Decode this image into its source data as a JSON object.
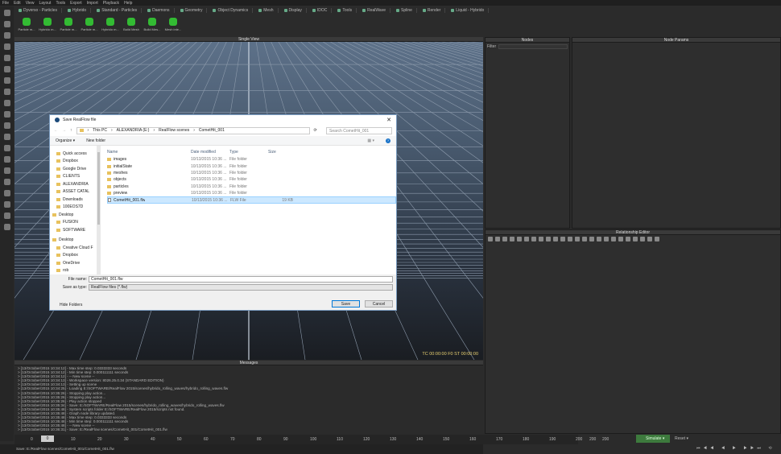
{
  "menu": [
    "File",
    "Edit",
    "View",
    "Layout",
    "Tools",
    "Export",
    "Import",
    "Playback",
    "Help"
  ],
  "shelf_tabs": [
    "Dyverso - Particles",
    "Hybrido",
    "Standard - Particles",
    "Daemons",
    "Geometry",
    "Object Dynamics",
    "Mesh",
    "Display",
    "IDOC",
    "Tools",
    "RealWave",
    "Spline",
    "Render",
    "Liquid - Hybrido"
  ],
  "shelf_tools": [
    "Particle m...",
    "Hybrido m...",
    "Particle m...",
    "Particle m...",
    "Hybrido m...",
    "Build Mesh",
    "Build Mes...",
    "Mesh inte..."
  ],
  "viewport": {
    "title": "Single View",
    "readout": "TC 00:00:00  F0  ST 00:00:00"
  },
  "dialog": {
    "title": "Save RealFlow file",
    "breadcrumb": [
      "This PC",
      "ALEXANDRIA (E:)",
      "RealFlow scenes",
      "CometHit_001"
    ],
    "search_placeholder": "Search CometHit_001",
    "organize": "Organize ▾",
    "new_folder": "New folder",
    "nav": [
      "Quick access",
      "Dropbox",
      "Google Drive",
      "CLIENTS",
      "ALEXANDRIA",
      "ASSET CATAL",
      "Downloads",
      "100EOS7D",
      "Desktop",
      "FUSION",
      "SOFTWARE",
      "Desktop",
      "Creative Cloud F",
      "Dropbox",
      "OneDrive",
      "rob"
    ],
    "columns": [
      "Name",
      "Date modified",
      "Type",
      "Size"
    ],
    "files": [
      {
        "name": "images",
        "date": "10/13/2015 10:36 ...",
        "type": "File folder",
        "size": ""
      },
      {
        "name": "initialState",
        "date": "10/13/2015 10:36 ...",
        "type": "File folder",
        "size": ""
      },
      {
        "name": "meshes",
        "date": "10/13/2015 10:36 ...",
        "type": "File folder",
        "size": ""
      },
      {
        "name": "objects",
        "date": "10/13/2015 10:36 ...",
        "type": "File folder",
        "size": ""
      },
      {
        "name": "particles",
        "date": "10/13/2015 10:36 ...",
        "type": "File folder",
        "size": ""
      },
      {
        "name": "preview",
        "date": "10/13/2015 10:36 ...",
        "type": "File folder",
        "size": ""
      },
      {
        "name": "CometHit_001.flw",
        "date": "10/13/2015 10:36 ...",
        "type": "FLW File",
        "size": "19 KB"
      }
    ],
    "file_name_label": "File name:",
    "file_name": "CometHit_001.flw",
    "save_type_label": "Save as type:",
    "save_type": "RealFlow files (*.flw)",
    "hide_folders": "Hide Folders",
    "save": "Save",
    "cancel": "Cancel"
  },
  "messages": {
    "title": "Messages",
    "lines": [
      "> [13/October/2015 10:34:12] - Max time step: 0.0333333 seconds",
      "> [13/October/2015 10:34:12] - Min time step: 0.000111111 seconds",
      "> [13/October/2015 10:34:12] - -- New scene --",
      "> [13/October/2015 10:34:13] - Workspace version: 8026.25.0.34 (STANDARD EDITION)",
      "> [13/October/2015 10:34:13] - Setting up scene",
      "> [13/October/2015 10:34:25] - Loading E:/SOFTWARE/RealFlow 2015/scenes/hybrido_rolling_waves/hybrido_rolling_waves.flw",
      "> [13/October/2015 10:35:26] - Stopping play action...",
      "> [13/October/2015 10:35:26] - Stopping play action...",
      "> [13/October/2015 10:35:26] - Play action stopped",
      "> [13/October/2015 10:35:34] - Save: E:/SOFTWARE/RealFlow 2015/scenes/hybrido_rolling_waves/hybrido_rolling_waves.flw",
      "> [13/October/2015 10:35:48] - System scripts folder E:/SOFTWARE/RealFlow 2015/scripts not found.",
      "> [13/October/2015 10:35:48] - Graph node library updated.",
      "> [13/October/2015 10:35:48] - Max time step: 0.0333333 seconds",
      "> [13/October/2015 10:35:48] - Min time step: 0.000111111 seconds",
      "> [13/October/2015 10:35:48] - -- New scene --",
      "> [13/October/2015 10:36:31] - Save: E:/RealFlow scenes/CometHit_001/CometHit_001.flw"
    ]
  },
  "timeline": {
    "start": "0",
    "current": "0",
    "ticks": [
      "10",
      "20",
      "30",
      "40",
      "50",
      "60",
      "70",
      "80",
      "90",
      "100",
      "110",
      "120",
      "130",
      "140",
      "150",
      "160",
      "170",
      "180",
      "190",
      "200"
    ],
    "end": "200",
    "end2": "200",
    "end3": "200"
  },
  "status": "Save: E:/RealFlow scenes/CometHit_001/CometHit_001.flw",
  "panels": {
    "nodes": "Nodes",
    "filter": "Filter",
    "node_params": "Node Params",
    "relationship": "Relationship Editor"
  },
  "controls": {
    "simulate": "Simulate",
    "reset": "Reset"
  }
}
